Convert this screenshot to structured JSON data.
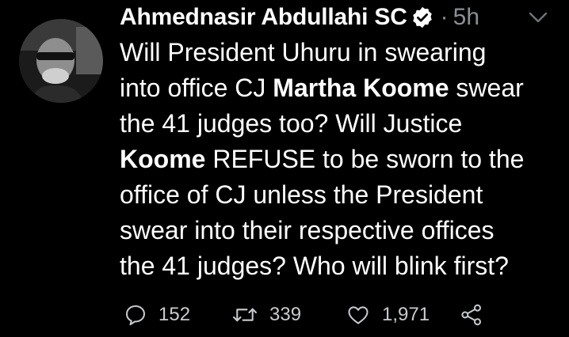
{
  "tweet": {
    "author": {
      "display_name": "Ahmednasir Abdullahi SC",
      "verified_icon": "verified-badge-icon"
    },
    "separator": "·",
    "time": "5h",
    "body_lines": [
      {
        "text": "Will President Uhuru in swearing"
      },
      {
        "pre": "into office CJ ",
        "bold": "Martha Koome",
        "post": " swear"
      },
      {
        "text": "the 41 judges too? Will Justice"
      },
      {
        "bold": "Koome",
        "post": " REFUSE to be sworn to the"
      },
      {
        "text": "office of CJ unless the President"
      },
      {
        "text": "swear into their respective offices"
      },
      {
        "text": "the 41 judges? Who will blink first?"
      }
    ],
    "actions": {
      "reply_count": "152",
      "retweet_count": "339",
      "like_count": "1,971"
    }
  },
  "colors": {
    "background": "#000000",
    "text": "#ffffff",
    "muted": "#8b9096"
  }
}
